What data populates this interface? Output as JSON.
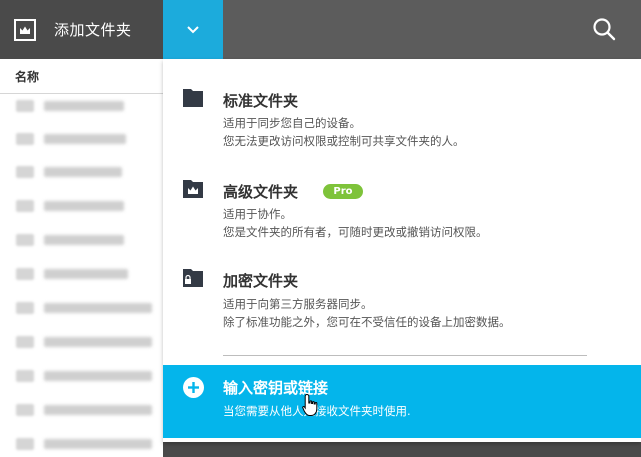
{
  "topbar": {
    "add_folder_label": "添加文件夹"
  },
  "file_list": {
    "column_name": "名称"
  },
  "dropdown": {
    "standard": {
      "title": "标准文件夹",
      "desc_line1": "适用于同步您自己的设备。",
      "desc_line2": "您无法更改访问权限或控制可共享文件夹的人。"
    },
    "advanced": {
      "title": "高级文件夹",
      "badge": "Pro",
      "desc_line1": "适用于协作。",
      "desc_line2": "您是文件夹的所有者，可随时更改或撤销访问权限。"
    },
    "encrypted": {
      "title": "加密文件夹",
      "desc_line1": "适用于向第三方服务器同步。",
      "desc_line2": "除了标准功能之外，您可在不受信任的设备上加密数据。"
    },
    "enter_key": {
      "title": "输入密钥或链接",
      "desc": "当您需要从他人处接收文件夹时使用."
    }
  },
  "colors": {
    "accent": "#1cabdc",
    "highlight": "#04b5eb",
    "pro_badge": "#7ec33a"
  }
}
